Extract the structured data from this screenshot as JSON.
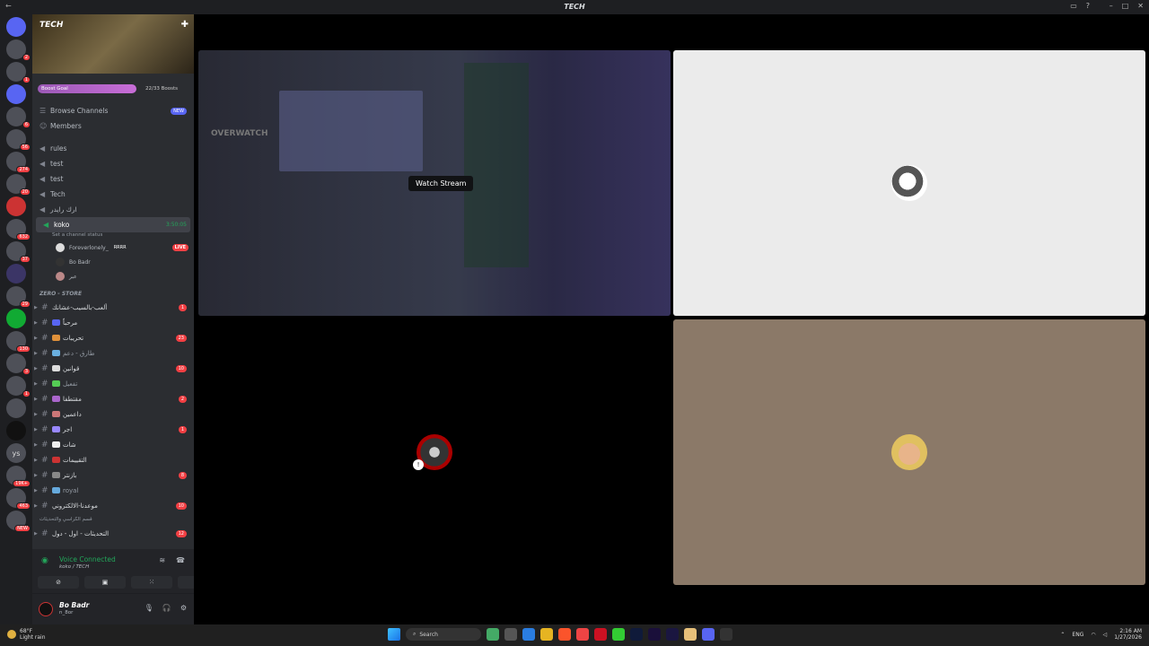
{
  "window": {
    "title": "TECH"
  },
  "server": {
    "name": "TECH",
    "boost_goal": "Boost Goal",
    "boost_count": "22/33 Boosts",
    "browse_channels": "Browse Channels",
    "new_badge": "NEW",
    "members": "Members"
  },
  "channels_top": [
    "rules",
    "test",
    "test",
    "Tech",
    "ارك رايدر"
  ],
  "voice": {
    "channel": "koko",
    "timer": "3:50:05",
    "status": "Set a channel status",
    "users": [
      {
        "name": "Foreverlonely_",
        "tag": "RRRR",
        "live": "LIVE"
      },
      {
        "name": "Bo Badr",
        "tag": "",
        "live": ""
      },
      {
        "name": "عبر",
        "tag": "",
        "live": ""
      }
    ]
  },
  "category": "ZERO - STORE",
  "store_channels": [
    {
      "name": "ألعب-بالسيب-عشانك",
      "badge": "1"
    },
    {
      "name": "مرحباً",
      "badge": ""
    },
    {
      "name": "تحريبات",
      "badge": "23"
    },
    {
      "name": "طارق - دعم",
      "badge": ""
    },
    {
      "name": "قوانين",
      "badge": "10"
    },
    {
      "name": "تفعيل",
      "badge": ""
    },
    {
      "name": "مقتطفا",
      "badge": "2"
    },
    {
      "name": "داعمين",
      "badge": ""
    },
    {
      "name": "اجر",
      "badge": "1"
    },
    {
      "name": "شات",
      "badge": ""
    },
    {
      "name": "التقييمات",
      "badge": ""
    },
    {
      "name": "بازنتر",
      "badge": "8"
    },
    {
      "name": "royal",
      "badge": ""
    },
    {
      "name": "موعدنا-الالكتروني",
      "badge": "10"
    }
  ],
  "category2": "قسم الكراسي والتحديثات",
  "last_channel": {
    "name": "التحديثات - اول - دول",
    "badge": "12"
  },
  "voice_panel": {
    "title": "Voice Connected",
    "subtitle": "koko / TECH"
  },
  "user_panel": {
    "name": "Bo Badr",
    "status": "n_8or"
  },
  "stream": {
    "game_label": "OVERWATCH",
    "watch_label": "Watch Stream"
  },
  "taskbar": {
    "temp": "68°F",
    "weather": "Light rain",
    "search": "Search",
    "lang": "ENG",
    "time": "2:16 AM",
    "date": "1/27/2026"
  },
  "server_badges": [
    "2",
    "1",
    "6",
    "56",
    "274",
    "20",
    "632",
    "37",
    "29",
    "130",
    "3",
    "1",
    "ys",
    "19K+",
    "463",
    "NEW"
  ],
  "colors": {
    "accent": "#5865f2",
    "online": "#23a55a",
    "danger": "#f23f43"
  }
}
